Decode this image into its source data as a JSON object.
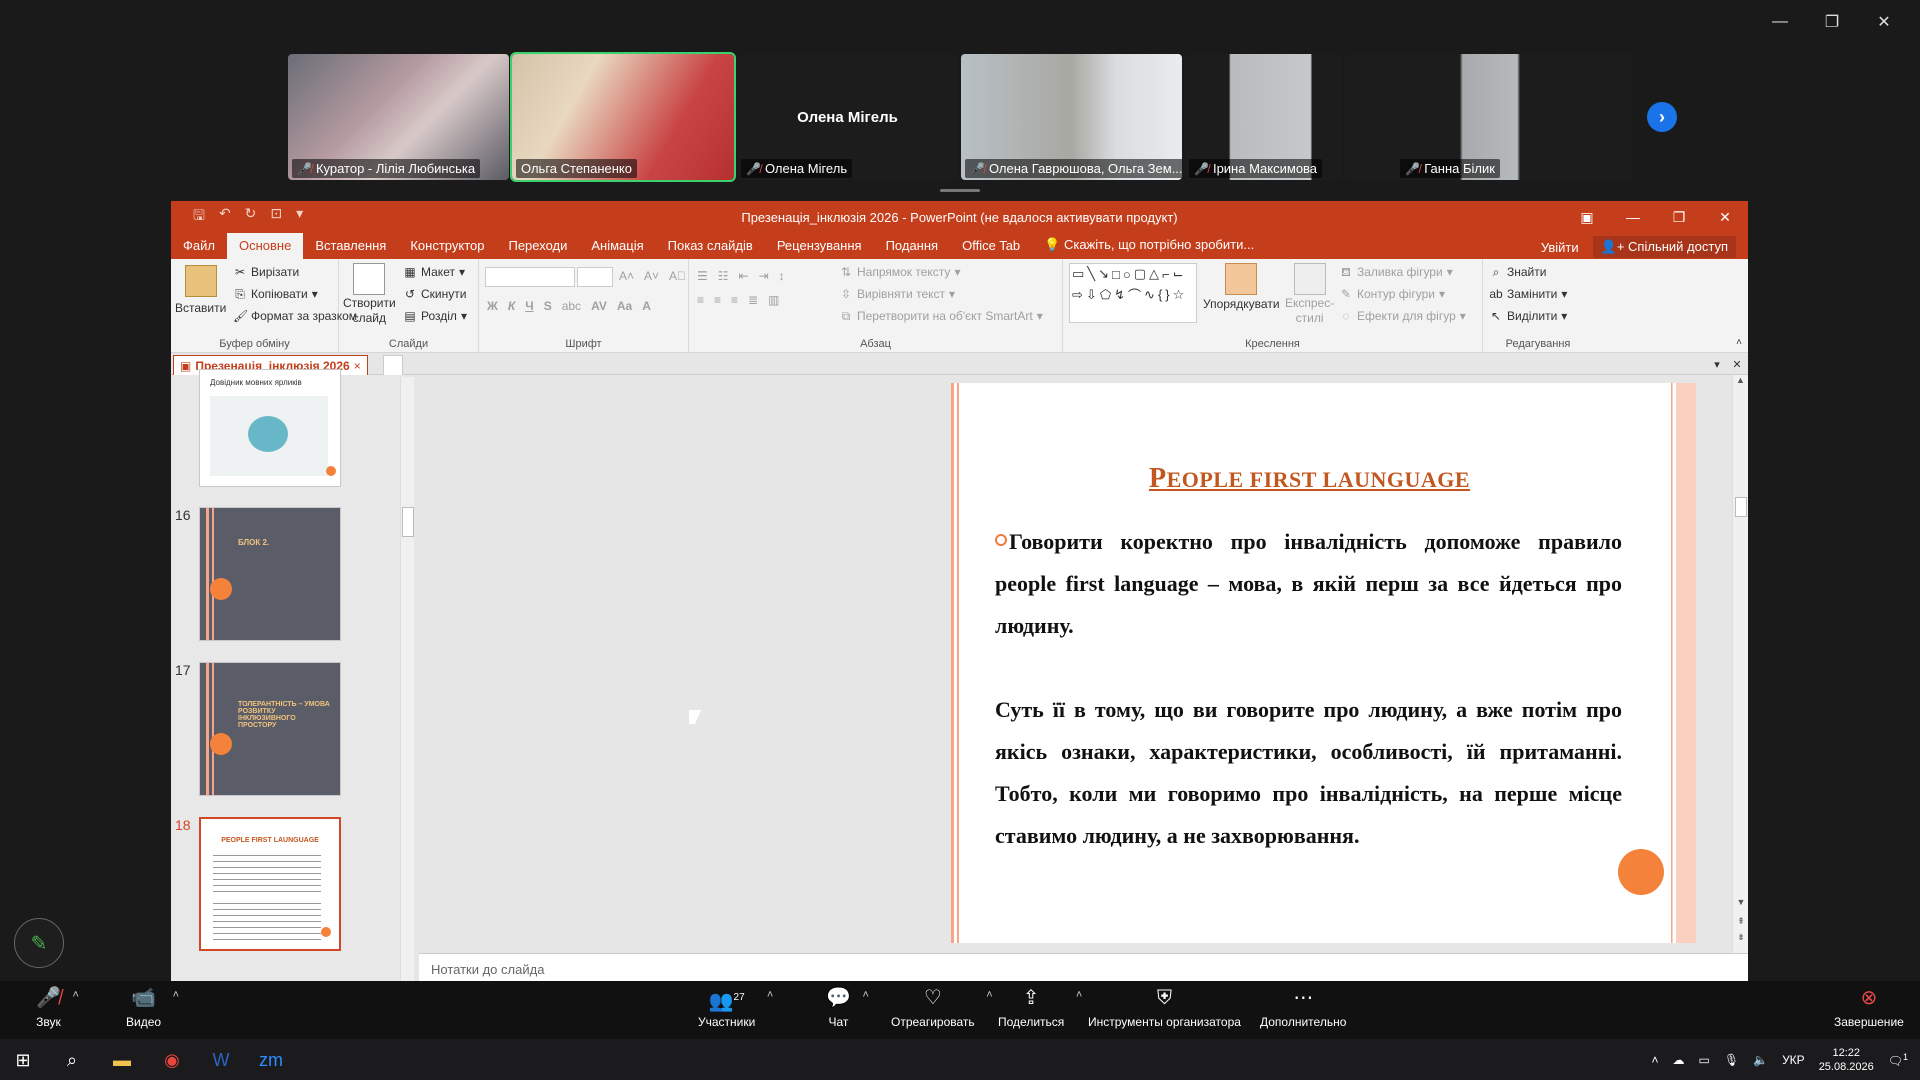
{
  "window": {
    "minimize": "—",
    "restore": "❐",
    "close": "✕"
  },
  "participants": [
    {
      "name": "Куратор - Лілія Любинська",
      "muted": true
    },
    {
      "name": "Ольга Степаненко",
      "muted": false
    },
    {
      "name": "Олена Мігель",
      "muted": true,
      "center_label": "Олена Мігель"
    },
    {
      "name": "Олена Гаврюшова, Ольга Зем...",
      "muted": true
    },
    {
      "name": "Ірина Максимова",
      "muted": true
    },
    {
      "name": "Ганна Білик",
      "muted": true
    }
  ],
  "ppt": {
    "title": "Презенація_інклюзія 2026 - PowerPoint (не вдалося активувати продукт)",
    "tabs": [
      "Файл",
      "Основне",
      "Вставлення",
      "Конструктор",
      "Переходи",
      "Анімація",
      "Показ слайдів",
      "Рецензування",
      "Подання",
      "Office Tab"
    ],
    "tell_me": "Скажіть, що потрібно зробити...",
    "sign_in": "Увійти",
    "share": "Спільний доступ",
    "ribbon": {
      "paste": "Вставити",
      "cut": "Вирізати",
      "copy": "Копіювати",
      "format_painter": "Формат за зразком",
      "clipboard_group": "Буфер обміну",
      "new_slide_1": "Створити",
      "new_slide_2": "слайд",
      "layout": "Макет",
      "reset": "Скинути",
      "section": "Розділ",
      "slides_group": "Слайди",
      "font_group": "Шрифт",
      "text_direction": "Напрямок тексту",
      "align_text": "Вирівняти текст",
      "convert_smartart": "Перетворити на об'єкт SmartArt",
      "paragraph_group": "Абзац",
      "arrange": "Упорядкувати",
      "quick_styles_1": "Експрес-",
      "quick_styles_2": "стилі",
      "shape_fill": "Заливка фігури",
      "shape_outline": "Контур фігури",
      "shape_effects": "Ефекти для фігур",
      "drawing_group": "Креслення",
      "find": "Знайти",
      "replace": "Замінити",
      "select": "Виділити",
      "editing_group": "Редагування"
    },
    "doc_tab": "Презенація_інклюзія 2026",
    "thumbnails": [
      {
        "num": "",
        "label": "Довідник мовних ярликів"
      },
      {
        "num": "16",
        "label": "БЛОК 2."
      },
      {
        "num": "17",
        "label": "ТОЛЕРАНТНІСТЬ – УМОВА РОЗВИТКУ ІНКЛЮЗИВНОГО ПРОСТОРУ"
      },
      {
        "num": "18",
        "label": "PEOPLE FIRST LAUNGUAGE"
      }
    ],
    "slide": {
      "title_first": "P",
      "title_rest1": "EOPLE FIRST LAUNGUAGE",
      "para1": "Говорити коректно про інвалідність допоможе правило people first language – мова, в якій перш за все йдеться про людину.",
      "para2": "Суть її в тому, що ви говорите про людину, а вже потім про якісь ознаки, характеристики, особливості, їй притаманні. Тобто, коли ми говоримо про інвалідність, на перше місце ставимо людину, а не захворювання."
    },
    "notes": "Нотатки до слайда"
  },
  "zoom_toolbar": {
    "audio": "Звук",
    "video": "Видео",
    "participants": "Участники",
    "participants_count": "27",
    "chat": "Чат",
    "react": "Отреагировать",
    "share": "Поделиться",
    "host_tools": "Инструменты организатора",
    "more": "Дополнительно",
    "end": "Завершение"
  },
  "taskbar": {
    "lang": "УКР",
    "time": "12:22",
    "date": "25.08.2026",
    "notifications": "1"
  },
  "colors": {
    "ppt_accent": "#c43e1c",
    "slide_title": "#c2571f",
    "orange_dot": "#f5823a",
    "active_speaker": "#3bd16f"
  }
}
